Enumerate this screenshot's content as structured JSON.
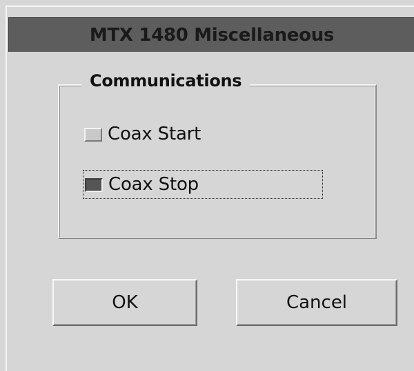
{
  "window": {
    "title": "MTX 1480 Miscellaneous"
  },
  "communications": {
    "legend": "Communications",
    "options": [
      {
        "label": "Coax Start",
        "selected": false
      },
      {
        "label": "Coax Stop",
        "selected": true
      }
    ]
  },
  "buttons": {
    "ok_label": "OK",
    "cancel_label": "Cancel"
  },
  "colors": {
    "titlebar_bg": "#5d5d5d",
    "window_bg": "#d6d6d6",
    "selected_indicator": "#555555"
  }
}
